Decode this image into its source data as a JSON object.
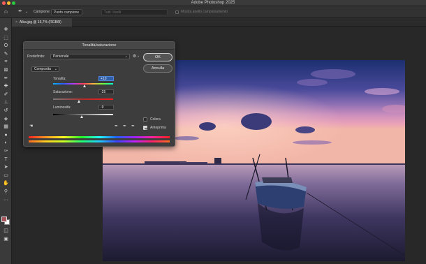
{
  "app": {
    "title": "Adobe Photoshop 2025",
    "traffic_lights": [
      "#ff5f57",
      "#febc2e",
      "#28c840"
    ]
  },
  "options_bar": {
    "sample_size_label": "Campione:",
    "sample_size_value": "Punto campione",
    "sample_layers_value": "Tutti i livelli",
    "show_ring_label": "Mostra anello campionamento"
  },
  "document": {
    "tab_label": "Alba.jpg @ 16,7% (RGB/8)",
    "close_glyph": "×"
  },
  "tools": [
    {
      "name": "move-tool-icon",
      "glyph": "✥"
    },
    {
      "name": "marquee-tool-icon",
      "glyph": "⬚"
    },
    {
      "name": "lasso-tool-icon",
      "glyph": "ʘ"
    },
    {
      "name": "quick-select-tool-icon",
      "glyph": "✎"
    },
    {
      "name": "crop-tool-icon",
      "glyph": "⌗"
    },
    {
      "name": "frame-tool-icon",
      "glyph": "⊠"
    },
    {
      "name": "eyedropper-tool-icon",
      "glyph": "✒"
    },
    {
      "name": "healing-brush-tool-icon",
      "glyph": "✚"
    },
    {
      "name": "brush-tool-icon",
      "glyph": "✐"
    },
    {
      "name": "clone-stamp-tool-icon",
      "glyph": "⊥"
    },
    {
      "name": "history-brush-tool-icon",
      "glyph": "↺"
    },
    {
      "name": "eraser-tool-icon",
      "glyph": "◈"
    },
    {
      "name": "gradient-tool-icon",
      "glyph": "▦"
    },
    {
      "name": "blur-tool-icon",
      "glyph": "●"
    },
    {
      "name": "dodge-tool-icon",
      "glyph": "◐"
    },
    {
      "name": "pen-tool-icon",
      "glyph": "✑"
    },
    {
      "name": "type-tool-icon",
      "glyph": "T"
    },
    {
      "name": "path-select-tool-icon",
      "glyph": "➤"
    },
    {
      "name": "rectangle-tool-icon",
      "glyph": "▭"
    },
    {
      "name": "hand-tool-icon",
      "glyph": "✋"
    },
    {
      "name": "zoom-tool-icon",
      "glyph": "⚲"
    },
    {
      "name": "more-tools-icon",
      "glyph": "···"
    }
  ],
  "colors": {
    "foreground": "#a8545a",
    "background": "#ffffff"
  },
  "dialog": {
    "title": "Tonalità/saturazione",
    "preset_label": "Predefinito:",
    "preset_value": "Personale",
    "channel_value": "Composita",
    "ok_label": "OK",
    "cancel_label": "Annulla",
    "hue_label": "Tonalità:",
    "hue_value": "+10",
    "hue_level": 0.53,
    "saturation_label": "Saturazione:",
    "saturation_value": "-25",
    "saturation_level": 0.44,
    "lightness_label": "Luminosità:",
    "lightness_value": "-9",
    "lightness_level": 0.48,
    "colorize_label": "Colora",
    "colorize_checked": false,
    "preview_label": "Anteprima",
    "preview_checked": true
  }
}
